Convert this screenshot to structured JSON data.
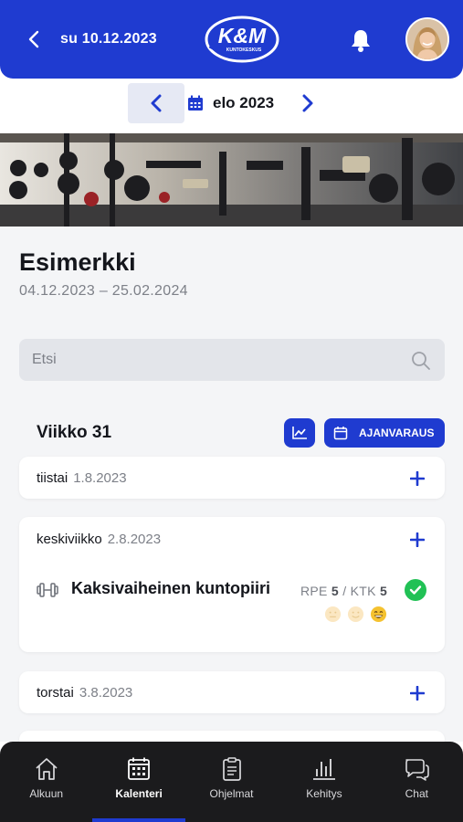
{
  "header": {
    "back_label": "back",
    "date": "su 10.12.2023",
    "logo_text": "K&M",
    "logo_sub": "KUNTOKESKUS"
  },
  "month_nav": {
    "label": "elo 2023"
  },
  "program": {
    "title": "Esimerkki",
    "dates": "04.12.2023 – 25.02.2024"
  },
  "search": {
    "placeholder": "Etsi"
  },
  "week": {
    "title": "Viikko 31",
    "booking_label": "AJANVARAUS"
  },
  "days": [
    {
      "name": "tiistai",
      "date": "1.8.2023"
    },
    {
      "name": "keskiviikko",
      "date": "2.8.2023",
      "workout": {
        "name": "Kaksivaiheinen kuntopiiri",
        "rpe_label": "RPE",
        "rpe": "5",
        "sep": "/",
        "ktk_label": "KTK",
        "ktk": "5"
      }
    },
    {
      "name": "torstai",
      "date": "3.8.2023"
    }
  ],
  "nav": [
    {
      "label": "Alkuun",
      "icon": "home-icon"
    },
    {
      "label": "Kalenteri",
      "icon": "calendar-icon"
    },
    {
      "label": "Ohjelmat",
      "icon": "clipboard-icon"
    },
    {
      "label": "Kehitys",
      "icon": "bar-chart-icon"
    },
    {
      "label": "Chat",
      "icon": "chat-icon"
    }
  ],
  "colors": {
    "primary": "#1f3bd0",
    "nav_bg": "#1b1b1d",
    "success": "#21c155"
  }
}
